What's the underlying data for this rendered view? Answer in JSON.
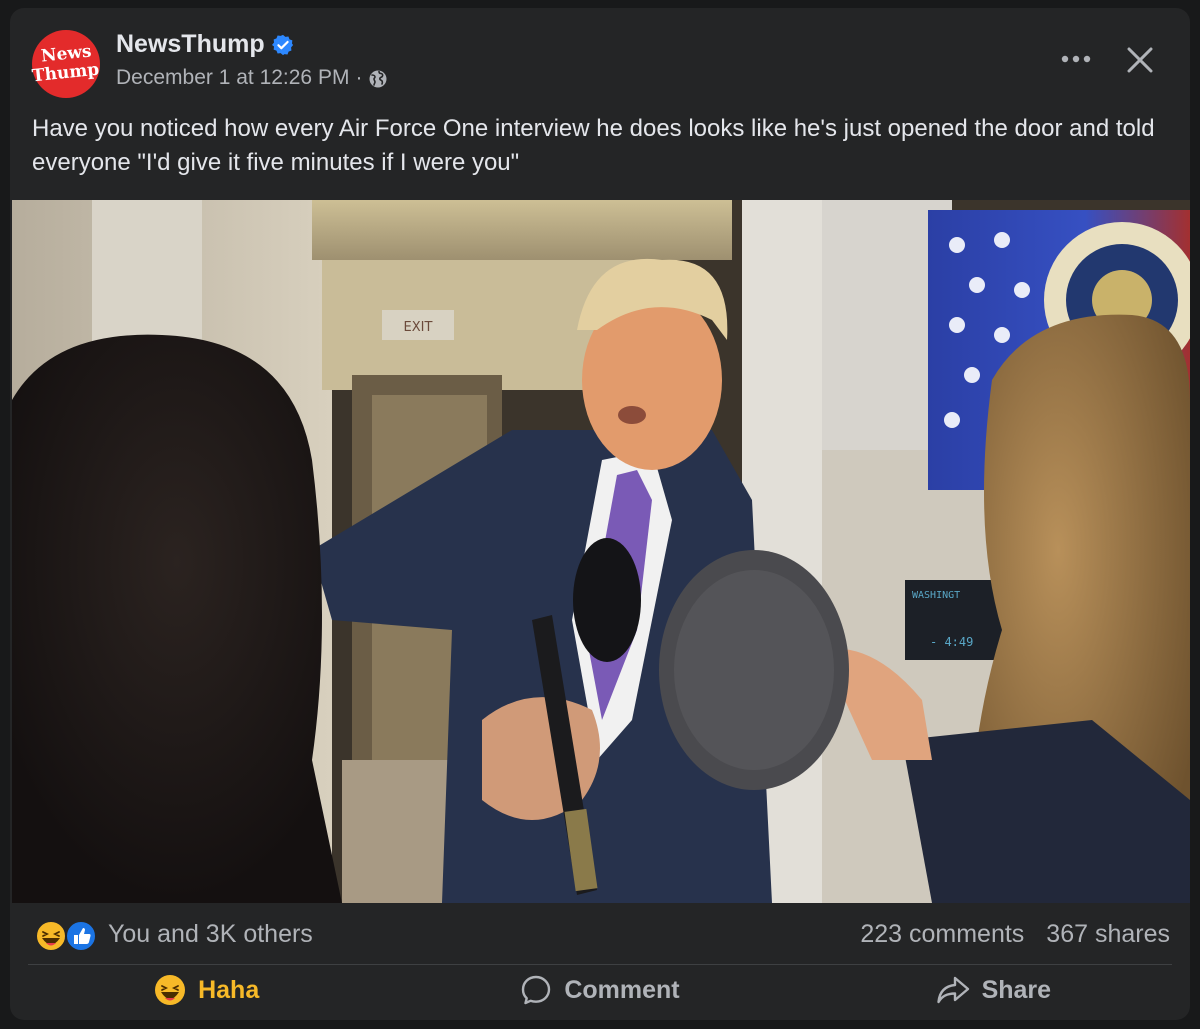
{
  "post": {
    "page_name": "NewsThump",
    "avatar_line1": "News",
    "avatar_line2": "Thump",
    "verified_icon": "verified-badge-icon",
    "timestamp": "December 1 at 12:26 PM",
    "separator": "·",
    "audience_icon": "globe-icon",
    "caption": "Have you noticed how every Air Force One interview he does looks like he's just opened the door and told everyone \"I'd give it five minutes if I were you\""
  },
  "header_actions": {
    "more_icon": "more-options-icon",
    "close_icon": "close-icon"
  },
  "media": {
    "display_text_1": "WASHINGT",
    "display_text_2": "- 4:49",
    "exit_sign": "EXIT"
  },
  "stats": {
    "reactions_text": "You and 3K others",
    "reaction_icons": [
      "haha-reaction-icon",
      "like-reaction-icon"
    ],
    "comments": "223 comments",
    "shares": "367 shares"
  },
  "actions": [
    {
      "label": "Haha",
      "icon": "haha-icon",
      "active": true
    },
    {
      "label": "Comment",
      "icon": "comment-icon",
      "active": false
    },
    {
      "label": "Share",
      "icon": "share-icon",
      "active": false
    }
  ],
  "colors": {
    "background": "#18191a",
    "card": "#242526",
    "primary_text": "#e4e6eb",
    "secondary_text": "#b0b3b8",
    "verified_blue": "#2d88ff",
    "haha_yellow": "#f7b928",
    "avatar_red": "#e32b2b"
  }
}
